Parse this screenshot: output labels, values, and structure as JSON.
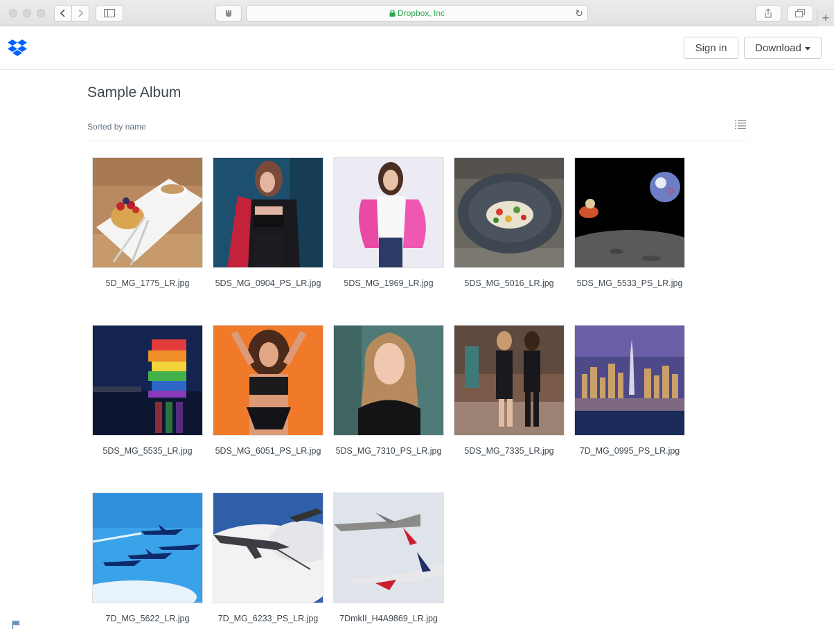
{
  "browser": {
    "url_text": "Dropbox, Inc",
    "back_icon": "chevron-left-icon",
    "forward_icon": "chevron-right-icon"
  },
  "header": {
    "logo_icon": "dropbox-logo-icon",
    "sign_in_label": "Sign in",
    "download_label": "Download",
    "accent_color": "#0061fe"
  },
  "album": {
    "title": "Sample Album",
    "sort_label": "Sorted by name",
    "view_icon": "list-view-icon"
  },
  "files": [
    {
      "name": "5D_MG_1775_LR.jpg"
    },
    {
      "name": "5DS_MG_0904_PS_LR.jpg"
    },
    {
      "name": "5DS_MG_1969_LR.jpg"
    },
    {
      "name": "5DS_MG_5016_LR.jpg"
    },
    {
      "name": "5DS_MG_5533_PS_LR.jpg"
    },
    {
      "name": "5DS_MG_5535_LR.jpg"
    },
    {
      "name": "5DS_MG_6051_PS_LR.jpg"
    },
    {
      "name": "5DS_MG_7310_PS_LR.jpg"
    },
    {
      "name": "5DS_MG_7335_LR.jpg"
    },
    {
      "name": "7D_MG_0995_PS_LR.jpg"
    },
    {
      "name": "7D_MG_5622_LR.jpg"
    },
    {
      "name": "7D_MG_6233_PS_LR.jpg"
    },
    {
      "name": "7DmkII_H4A9869_LR.jpg"
    }
  ]
}
